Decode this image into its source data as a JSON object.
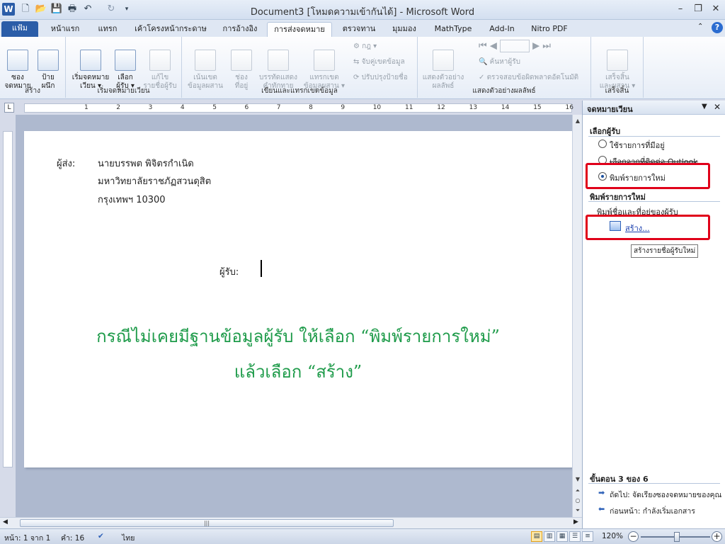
{
  "title_bar": {
    "title": "Document3 [โหมดความเข้ากันได้] - Microsoft Word",
    "app_icon": "W",
    "quick_access": [
      "save-icon",
      "print-icon",
      "undo-icon",
      "redo-icon",
      "customize-icon"
    ]
  },
  "tabs": [
    "แฟ้ม",
    "หน้าแรก",
    "แทรก",
    "เค้าโครงหน้ากระดาษ",
    "การอ้างอิง",
    "การส่งจดหมาย",
    "ตรวจทาน",
    "มุมมอง",
    "MathType",
    "Add-In",
    "Nitro PDF"
  ],
  "active_tab": "การส่งจดหมาย",
  "ribbon": {
    "create": {
      "label": "สร้าง",
      "envelopes": "ซอง\nจดหมาย",
      "labels": "ป้าย\nผนึก"
    },
    "start": {
      "label": "เริ่มจดหมายเวียน",
      "start_merge": "เริ่มจดหมาย\nเวียน ▾",
      "select_recipients": "เลือก\nผู้รับ ▾",
      "edit_list": "แก้ไข\nรายชื่อผู้รับ"
    },
    "write": {
      "label": "เขียนและแทรกเขตข้อมูล",
      "highlight": "เน้นเขต\nข้อมูลผสาน",
      "address_block": "ช่อง\nที่อยู่",
      "greeting": "บรรทัดแสดง\nคำทักทาย",
      "insert_field": "แทรกเขต\nข้อมูลผสาน ▾",
      "rules": "กฎ ▾",
      "match_fields": "จับคู่เขตข้อมูล",
      "update_labels": "ปรับปรุงป้ายชื่อ"
    },
    "preview": {
      "label": "แสดงตัวอย่างผลลัพธ์",
      "preview_results": "แสดงตัวอย่าง\nผลลัพธ์",
      "find_recipient": "ค้นหาผู้รับ",
      "check_errors": "ตรวจสอบข้อผิดพลาดอัตโนมัติ"
    },
    "finish": {
      "label": "เสร็จสิ้น",
      "finish_merge": "เสร็จสิ้น\nและผสาน ▾"
    }
  },
  "ruler": {
    "numbers": [
      "1",
      "2",
      "3",
      "4",
      "5",
      "6",
      "7",
      "8",
      "9",
      "10",
      "11",
      "12",
      "13",
      "14",
      "15",
      "16"
    ]
  },
  "document": {
    "sender_label": "ผู้ส่ง:",
    "sender_lines": [
      "นายบรรพต พิจิตรกำเนิด",
      "มหาวิทยาลัยราชภัฏสวนดุสิต",
      "กรุงเทพฯ 10300"
    ],
    "recipient_label": "ผู้รับ:",
    "instruction_line1": "กรณีไม่เคยมีฐานข้อมูลผู้รับ ให้เลือก “พิมพ์รายการใหม่”",
    "instruction_line2": "แล้วเลือก “สร้าง”"
  },
  "task_pane": {
    "title": "จดหมายเวียน",
    "select_recipients_heading": "เลือกผู้รับ",
    "options": [
      "ใช้รายการที่มีอยู่",
      "เลือกจากที่ติดต่อ Outlook",
      "พิมพ์รายการใหม่"
    ],
    "selected_option": "พิมพ์รายการใหม่",
    "new_list_heading": "พิมพ์รายการใหม่",
    "new_list_desc": "พิมพ์ชื่อและที่อยู่ของผู้รับ",
    "create_link": "สร้าง...",
    "tooltip": "สร้างรายชื่อผู้รับใหม่",
    "step": "ขั้นตอน 3 ของ 6",
    "next": "ถัดไป: จัดเรียงซองจดหมายของคุณ",
    "previous": "ก่อนหน้า: กำลังเริ่มเอกสาร",
    "highlight_color": "#e0001a"
  },
  "status_bar": {
    "page": "หน้า: 1 จาก 1",
    "words": "คำ: 16",
    "language": "ไทย",
    "zoom": "120%",
    "zoom_level": 120
  }
}
